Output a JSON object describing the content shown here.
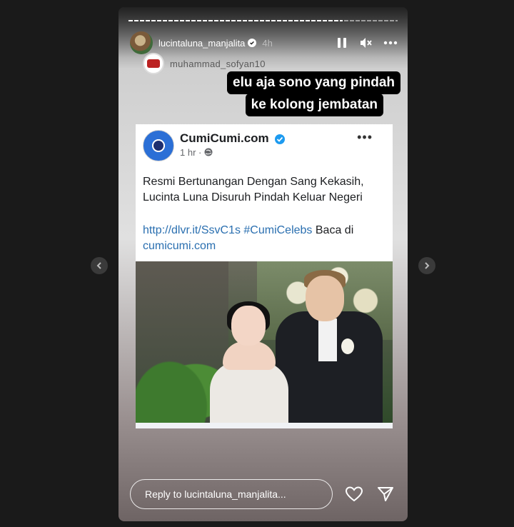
{
  "story": {
    "username": "lucintaluna_manjalita",
    "time": "4h",
    "repost_username": "muhammad_sofyan10",
    "caption_lines": [
      "elu aja sono yang pindah",
      "ke kolong jembatan"
    ]
  },
  "post": {
    "page_name": "CumiCumi.com",
    "meta": "1 hr · ",
    "more": "•••",
    "text_line1": "Resmi Bertunangan Dengan Sang Kekasih,",
    "text_line2": "Lucinta Luna Disuruh Pindah Keluar Negeri",
    "link1": "http://dlvr.it/SsvC1s",
    "hashtag": "#CumiCelebs",
    "baca": " Baca di",
    "link2": "cumicumi.com"
  },
  "footer": {
    "reply_placeholder": "Reply to lucintaluna_manjalita..."
  },
  "colors": {
    "link": "#2a6fb0",
    "verified_blue": "#1d9bf0"
  },
  "icons": [
    "pause-icon",
    "mute-icon",
    "more-icon",
    "heart-icon",
    "send-icon",
    "chevron-left-icon",
    "chevron-right-icon"
  ]
}
